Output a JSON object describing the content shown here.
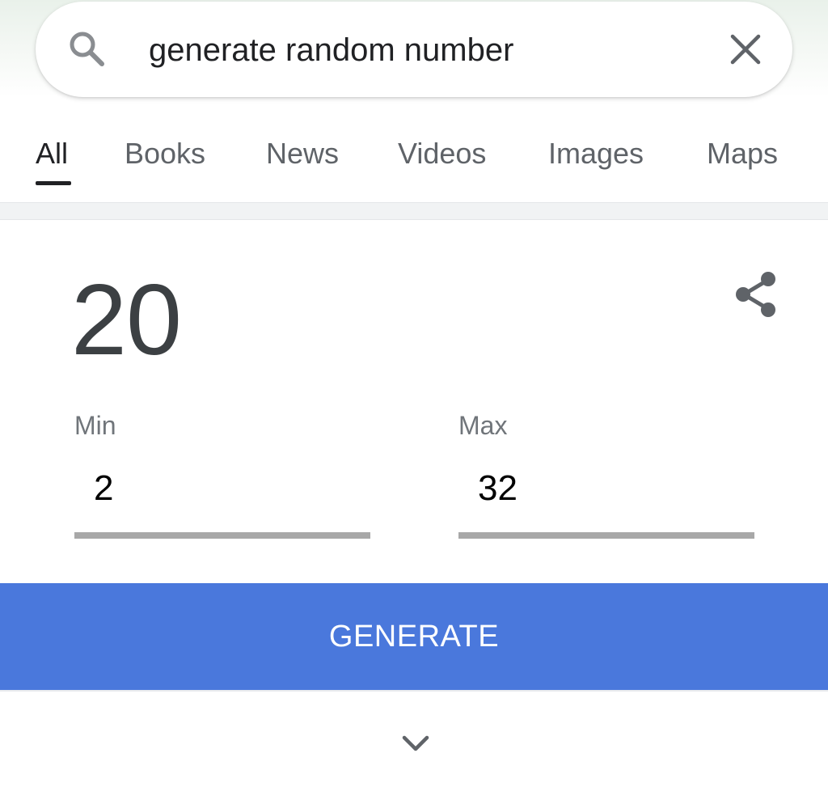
{
  "search": {
    "query": "generate random number",
    "icon": "search-icon",
    "clear_icon": "close-icon"
  },
  "tabs": [
    {
      "label": "All",
      "active": true
    },
    {
      "label": "Books",
      "active": false
    },
    {
      "label": "News",
      "active": false
    },
    {
      "label": "Videos",
      "active": false
    },
    {
      "label": "Images",
      "active": false
    },
    {
      "label": "Maps",
      "active": false
    }
  ],
  "generator": {
    "result": "20",
    "share_icon": "share-icon",
    "min": {
      "label": "Min",
      "value": "2"
    },
    "max": {
      "label": "Max",
      "value": "32"
    },
    "button_label": "GENERATE",
    "expand_icon": "chevron-down-icon"
  },
  "colors": {
    "button": "#4a78dc",
    "underline": "#a8a8a8",
    "active_tab": "#202124",
    "inactive_tab": "#5f6368"
  }
}
